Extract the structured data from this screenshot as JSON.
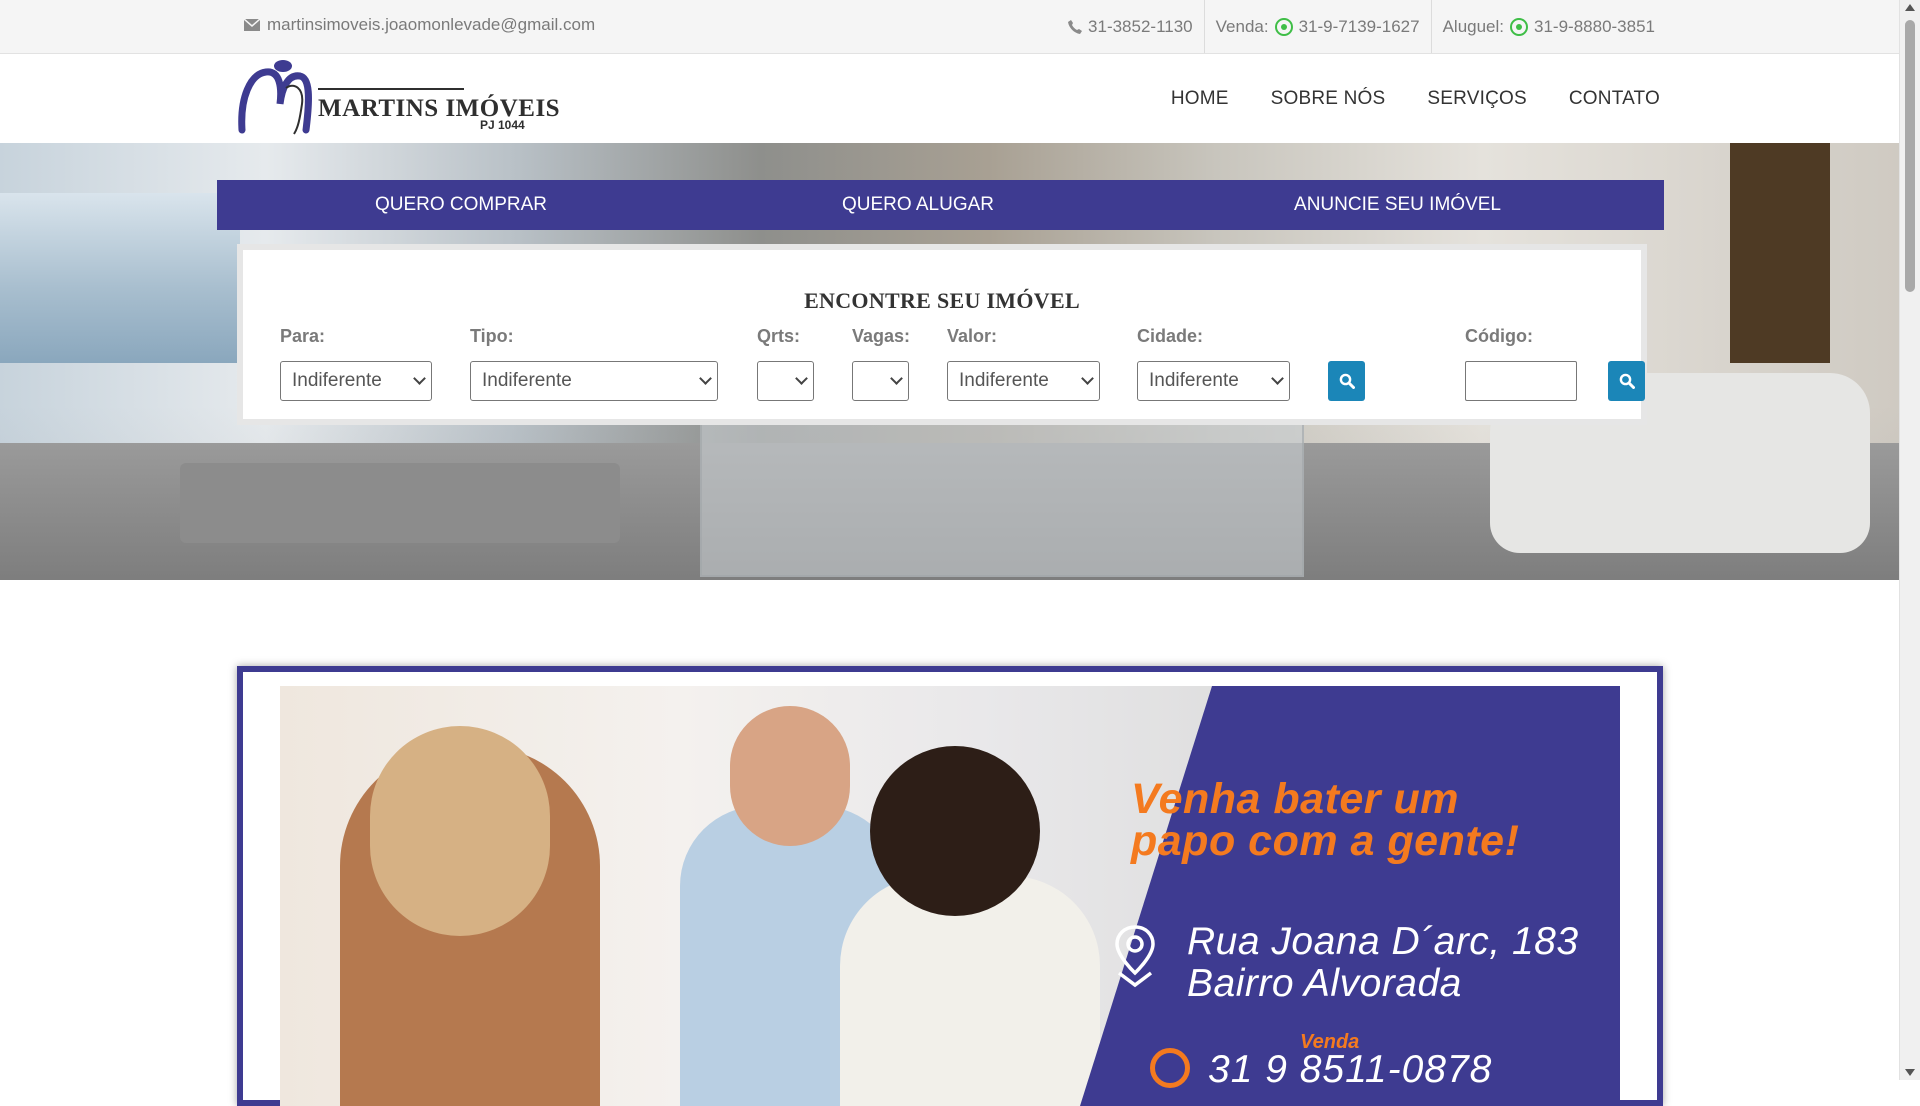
{
  "topbar": {
    "email": "martinsimoveis.joaomonlevade@gmail.com",
    "phone": "31-3852-1130",
    "venda_label": "Venda:",
    "venda_phone": "31-9-7139-1627",
    "aluguel_label": "Aluguel:",
    "aluguel_phone": "31-9-8880-3851",
    "whatsapp_color": "#3fbe47"
  },
  "logo": {
    "name": "MARTINS IMÓVEIS",
    "registration": "PJ 1044"
  },
  "nav": {
    "items": [
      "HOME",
      "SOBRE NÓS",
      "SERVIÇOS",
      "CONTATO"
    ]
  },
  "tabs": {
    "items": [
      "QUERO COMPRAR",
      "QUERO ALUGAR",
      "ANUNCIE SEU IMÓVEL"
    ],
    "color": "#3e3b91"
  },
  "search": {
    "title": "ENCONTRE SEU IMÓVEL",
    "para": {
      "label": "Para:",
      "value": "Indiferente"
    },
    "tipo": {
      "label": "Tipo:",
      "value": "Indiferente"
    },
    "qrts": {
      "label": "Qrts:",
      "value": ""
    },
    "vagas": {
      "label": "Vagas:",
      "value": ""
    },
    "valor": {
      "label": "Valor:",
      "value": "Indiferente"
    },
    "cidade": {
      "label": "Cidade:",
      "value": "Indiferente"
    },
    "codigo": {
      "label": "Código:",
      "value": ""
    },
    "button_color": "#1b86b8"
  },
  "banner": {
    "headline_line1": "Venha bater um",
    "headline_line2": "papo com a gente!",
    "address_line1": "Rua Joana D´arc, 183",
    "address_line2": "Bairro Alvorada",
    "venda_label": "Venda",
    "phone": "31 9 8511-0878",
    "accent": "#f47a1f",
    "panel_color": "#3e3b91"
  }
}
